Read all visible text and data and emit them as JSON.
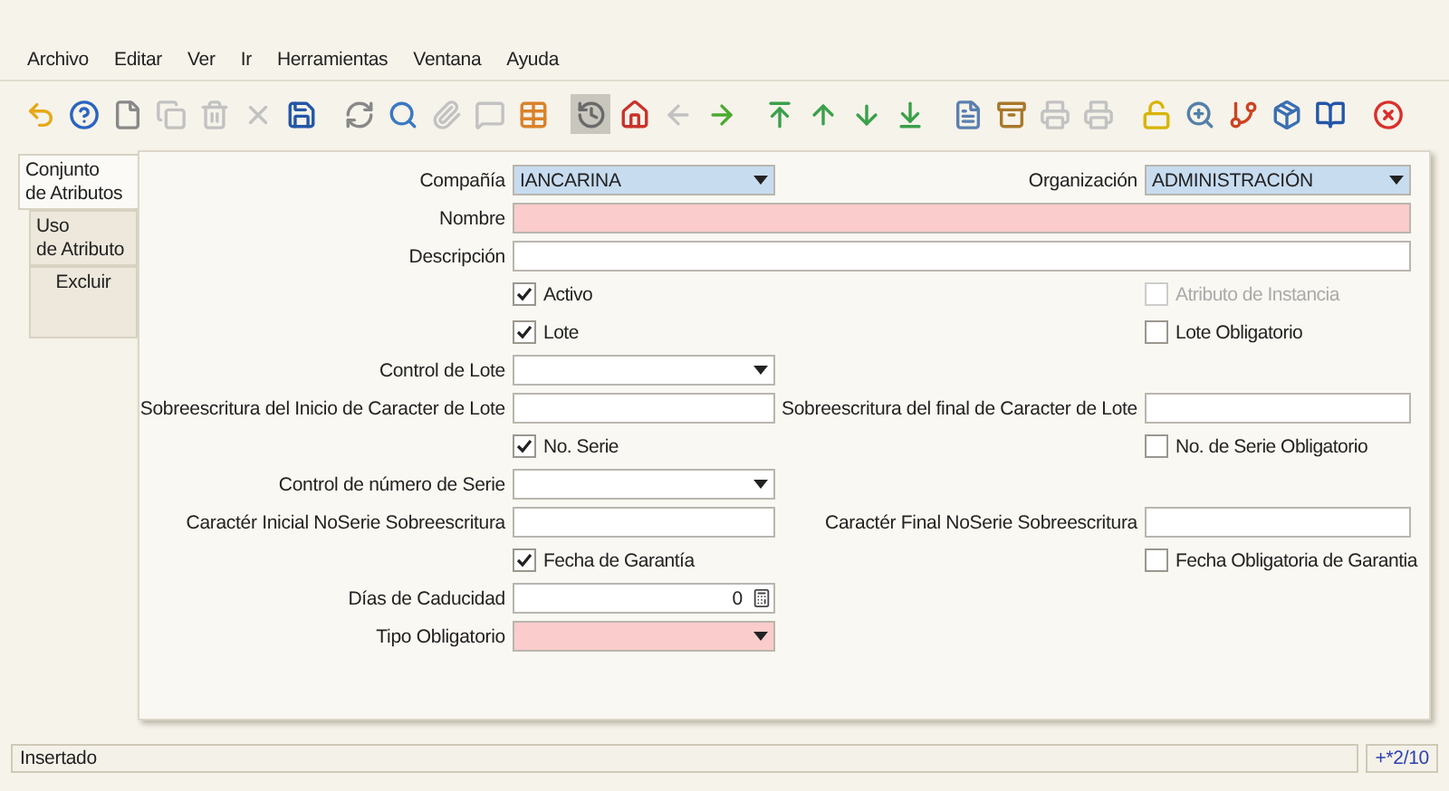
{
  "menu": [
    "Archivo",
    "Editar",
    "Ver",
    "Ir",
    "Herramientas",
    "Ventana",
    "Ayuda"
  ],
  "toolbar": [
    {
      "kind": "undo",
      "selected": false,
      "disabled": false
    },
    {
      "kind": "help",
      "selected": false,
      "disabled": false
    },
    {
      "kind": "new",
      "selected": false,
      "disabled": false
    },
    {
      "kind": "copy",
      "selected": false,
      "disabled": true
    },
    {
      "kind": "delete",
      "selected": false,
      "disabled": true
    },
    {
      "kind": "delete-multi",
      "selected": false,
      "disabled": true
    },
    {
      "kind": "save",
      "selected": false,
      "disabled": false
    },
    {
      "kind": "refresh",
      "selected": false,
      "disabled": false
    },
    {
      "kind": "find",
      "selected": false,
      "disabled": false
    },
    {
      "kind": "attach",
      "selected": false,
      "disabled": true
    },
    {
      "kind": "chat",
      "selected": false,
      "disabled": true
    },
    {
      "kind": "grid",
      "selected": false,
      "disabled": false
    },
    {
      "kind": "history",
      "selected": true,
      "disabled": false
    },
    {
      "kind": "home",
      "selected": false,
      "disabled": false
    },
    {
      "kind": "back",
      "selected": false,
      "disabled": true
    },
    {
      "kind": "forward",
      "selected": false,
      "disabled": false
    },
    {
      "kind": "first",
      "selected": false,
      "disabled": false
    },
    {
      "kind": "prev",
      "selected": false,
      "disabled": false
    },
    {
      "kind": "next",
      "selected": false,
      "disabled": false
    },
    {
      "kind": "last",
      "selected": false,
      "disabled": false
    },
    {
      "kind": "report",
      "selected": false,
      "disabled": false
    },
    {
      "kind": "archive",
      "selected": false,
      "disabled": false
    },
    {
      "kind": "print",
      "selected": false,
      "disabled": true
    },
    {
      "kind": "print",
      "selected": false,
      "disabled": true
    },
    {
      "kind": "lock",
      "selected": false,
      "disabled": false
    },
    {
      "kind": "zoom",
      "selected": false,
      "disabled": false
    },
    {
      "kind": "workflow",
      "selected": false,
      "disabled": false
    },
    {
      "kind": "product",
      "selected": false,
      "disabled": false
    },
    {
      "kind": "book",
      "selected": false,
      "disabled": false
    },
    {
      "kind": "exit",
      "selected": false,
      "disabled": false
    }
  ],
  "tabs": [
    {
      "label": "Conjunto\nde Atributos",
      "selected": true
    },
    {
      "label": "Uso\nde Atributo",
      "selected": false
    },
    {
      "label": "Excluir",
      "selected": false
    }
  ],
  "form": {
    "rows": [
      {
        "left": {
          "kind": "select",
          "label": "Compañía",
          "value": "IANCARINA",
          "readonly": true,
          "mandatory": false
        },
        "right": {
          "kind": "select",
          "label": "Organización",
          "value": "ADMINISTRACIÓN",
          "readonly": true,
          "mandatory": false
        }
      },
      {
        "left": {
          "kind": "text",
          "label": "Nombre",
          "wide": true,
          "readonly": false,
          "mandatory": true
        }
      },
      {
        "left": {
          "kind": "text",
          "label": "Descripción",
          "wide": true,
          "readonly": false,
          "mandatory": false
        }
      },
      {
        "left": {
          "kind": "checkbox",
          "label": "Activo",
          "checked": true,
          "disabled": false
        },
        "right": {
          "kind": "checkbox",
          "label": "Atributo de Instancia",
          "checked": false,
          "disabled": true
        }
      },
      {
        "left": {
          "kind": "checkbox",
          "label": "Lote",
          "checked": true,
          "disabled": false
        },
        "right": {
          "kind": "checkbox",
          "label": "Lote Obligatorio",
          "checked": false,
          "disabled": false
        }
      },
      {
        "left": {
          "kind": "select",
          "label": "Control de Lote",
          "readonly": false,
          "mandatory": false
        }
      },
      {
        "left": {
          "kind": "text",
          "label": "Sobreescritura del Inicio de Caracter de Lote",
          "readonly": false,
          "mandatory": false
        },
        "right": {
          "kind": "text",
          "label": "Sobreescritura del final de Caracter de Lote",
          "readonly": false,
          "mandatory": false
        }
      },
      {
        "left": {
          "kind": "checkbox",
          "label": "No. Serie",
          "checked": true,
          "disabled": false
        },
        "right": {
          "kind": "checkbox",
          "label": "No. de Serie Obligatorio",
          "checked": false,
          "disabled": false
        }
      },
      {
        "left": {
          "kind": "select",
          "label": "Control de número de Serie",
          "readonly": false,
          "mandatory": false
        }
      },
      {
        "left": {
          "kind": "text",
          "label": "Caractér Inicial NoSerie Sobreescritura",
          "readonly": false,
          "mandatory": false
        },
        "right": {
          "kind": "text",
          "label": "Caractér Final NoSerie Sobreescritura",
          "readonly": false,
          "mandatory": false
        }
      },
      {
        "left": {
          "kind": "checkbox",
          "label": "Fecha de Garantía",
          "checked": true,
          "disabled": false
        },
        "right": {
          "kind": "checkbox",
          "label": "Fecha Obligatoria de Garantia",
          "checked": false,
          "disabled": false
        }
      },
      {
        "left": {
          "kind": "number",
          "label": "Días de Caducidad",
          "value": "0",
          "readonly": false,
          "mandatory": false
        }
      },
      {
        "left": {
          "kind": "select",
          "label": "Tipo Obligatorio",
          "readonly": false,
          "mandatory": true
        }
      }
    ]
  },
  "status_bar": {
    "message": "Insertado",
    "record": "+*2/10"
  }
}
